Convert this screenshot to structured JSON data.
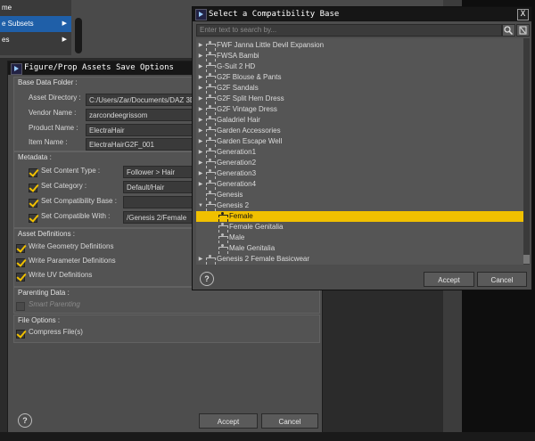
{
  "background_menu": {
    "items": [
      {
        "label": "me"
      },
      {
        "label": "e Subsets"
      },
      {
        "label": "es"
      }
    ]
  },
  "save_dialog": {
    "title": "Figure/Prop Assets Save Options",
    "base_data": {
      "group_label": "Base Data Folder :",
      "asset_directory_label": "Asset Directory :",
      "asset_directory_value": "C:/Users/Zar/Documents/DAZ 3D",
      "vendor_name_label": "Vendor Name :",
      "vendor_name_value": "zarcondeegrissom",
      "product_name_label": "Product Name :",
      "product_name_value": "ElectraHair",
      "item_name_label": "Item Name :",
      "item_name_value": "ElectraHairG2F_001"
    },
    "metadata": {
      "group_label": "Metadata :",
      "content_type_label": "Set Content Type :",
      "content_type_value": "Follower > Hair",
      "category_label": "Set Category :",
      "category_value": "Default/Hair",
      "compat_base_label": "Set Compatibility Base :",
      "compat_base_value": "",
      "compatible_with_label": "Set Compatible With :",
      "compatible_with_value": "/Genesis 2/Female"
    },
    "asset_definitions": {
      "group_label": "Asset Definitions :",
      "geometry_label": "Write Geometry Definitions",
      "parameter_label": "Write Parameter Definitions",
      "uv_label": "Write UV Definitions"
    },
    "parenting": {
      "group_label": "Parenting Data :",
      "smart_parenting_label": "Smart Parenting"
    },
    "file_options": {
      "group_label": "File Options :",
      "compress_label": "Compress File(s)"
    },
    "help_label": "?",
    "accept_label": "Accept",
    "cancel_label": "Cancel"
  },
  "compat_dialog": {
    "title": "Select a Compatibility Base",
    "close_label": "X",
    "search_placeholder": "Enter text to search by...",
    "tree": [
      {
        "label": "FWF Janna Little Devil Expansion",
        "depth": 0,
        "arrow": "▶"
      },
      {
        "label": "FWSA Bambi",
        "depth": 0,
        "arrow": "▶"
      },
      {
        "label": "G-Suit 2 HD",
        "depth": 0,
        "arrow": "▶"
      },
      {
        "label": "G2F Blouse & Pants",
        "depth": 0,
        "arrow": "▶"
      },
      {
        "label": "G2F Sandals",
        "depth": 0,
        "arrow": "▶"
      },
      {
        "label": "G2F Split Hem Dress",
        "depth": 0,
        "arrow": "▶"
      },
      {
        "label": "G2F Vintage Dress",
        "depth": 0,
        "arrow": "▶"
      },
      {
        "label": "Galadriel Hair",
        "depth": 0,
        "arrow": "▶"
      },
      {
        "label": "Garden Accessories",
        "depth": 0,
        "arrow": "▶"
      },
      {
        "label": "Garden Escape Well",
        "depth": 0,
        "arrow": "▶"
      },
      {
        "label": "Generation1",
        "depth": 0,
        "arrow": "▶"
      },
      {
        "label": "Generation2",
        "depth": 0,
        "arrow": "▶"
      },
      {
        "label": "Generation3",
        "depth": 0,
        "arrow": "▶"
      },
      {
        "label": "Generation4",
        "depth": 0,
        "arrow": "▶"
      },
      {
        "label": "Genesis",
        "depth": 0,
        "arrow": ""
      },
      {
        "label": "Genesis 2",
        "depth": 0,
        "arrow": "▼"
      },
      {
        "label": "Female",
        "depth": 1,
        "arrow": "",
        "selected": true
      },
      {
        "label": "Female Genitalia",
        "depth": 1,
        "arrow": ""
      },
      {
        "label": "Male",
        "depth": 1,
        "arrow": ""
      },
      {
        "label": "Male Genitalia",
        "depth": 1,
        "arrow": ""
      },
      {
        "label": "Genesis 2 Female Basicwear",
        "depth": 0,
        "arrow": "▶"
      }
    ],
    "help_label": "?",
    "accept_label": "Accept",
    "cancel_label": "Cancel"
  },
  "colors": {
    "selection": "#f0c000",
    "menu_highlight": "#1f5fa8",
    "titlebar": "#161616",
    "dialog_bg": "#4d4d4d"
  }
}
